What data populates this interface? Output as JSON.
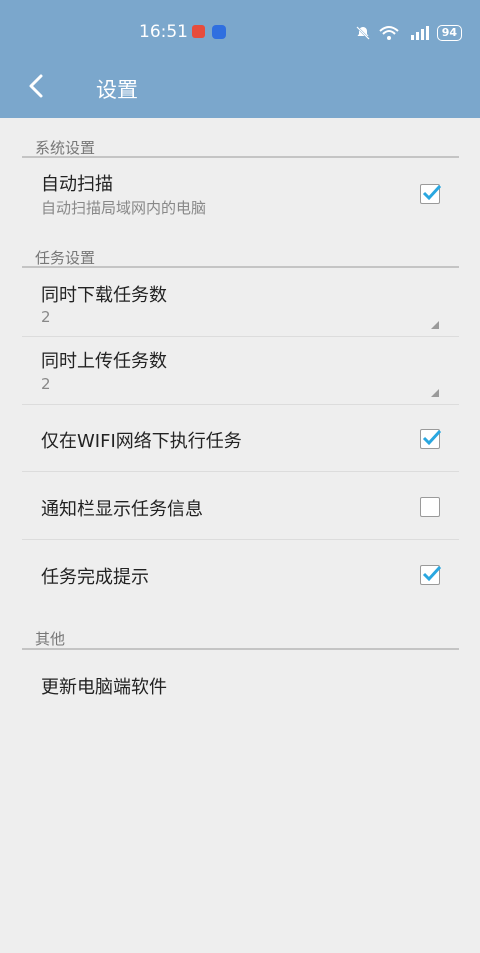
{
  "status_bar": {
    "time": "16:51",
    "battery": "94"
  },
  "header": {
    "title": "设置"
  },
  "sections": {
    "system": {
      "title": "系统设置",
      "auto_scan": {
        "title": "自动扫描",
        "summary": "自动扫描局域网内的电脑",
        "checked": true
      }
    },
    "task": {
      "title": "任务设置",
      "download_count": {
        "title": "同时下载任务数",
        "value": "2"
      },
      "upload_count": {
        "title": "同时上传任务数",
        "value": "2"
      },
      "wifi_only": {
        "title": "仅在WIFI网络下执行任务",
        "checked": true
      },
      "notify_bar": {
        "title": "通知栏显示任务信息",
        "checked": false
      },
      "complete_tip": {
        "title": "任务完成提示",
        "checked": true
      }
    },
    "other": {
      "title": "其他",
      "update_pc": {
        "title": "更新电脑端软件"
      }
    }
  },
  "colors": {
    "accent": "#2aa7e0",
    "header": "#7ba7cc"
  }
}
